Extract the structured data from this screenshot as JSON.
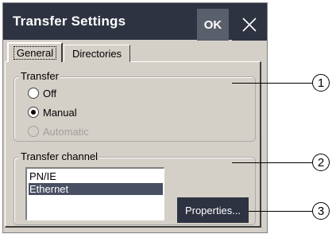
{
  "window": {
    "title": "Transfer Settings",
    "ok_label": "OK",
    "close_icon": "close-x-icon"
  },
  "tabs": [
    {
      "label": "General",
      "active": true
    },
    {
      "label": "Directories",
      "active": false
    }
  ],
  "transfer": {
    "group_label": "Transfer",
    "options": [
      {
        "label": "Off",
        "checked": false,
        "enabled": true
      },
      {
        "label": "Manual",
        "checked": true,
        "enabled": true
      },
      {
        "label": "Automatic",
        "checked": false,
        "enabled": false
      }
    ]
  },
  "channel": {
    "group_label": "Transfer channel",
    "items": [
      "PN/IE",
      "Ethernet"
    ],
    "selected": "Ethernet",
    "properties_label": "Properties..."
  },
  "callouts": [
    "1",
    "2",
    "3"
  ],
  "colors": {
    "titlebar": "#2e3342",
    "ok_button": "#5a5f6c",
    "panel": "#d4d0c8",
    "selection": "#4a5063"
  }
}
